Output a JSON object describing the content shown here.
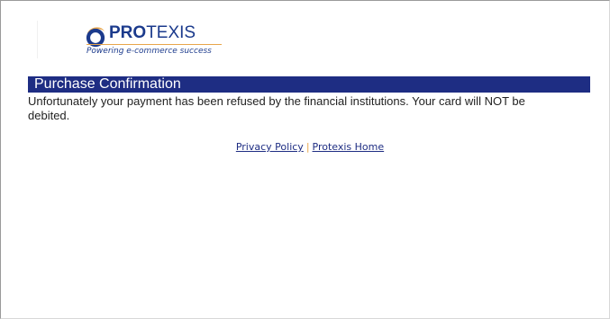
{
  "logo": {
    "brand_prefix": "PRO",
    "brand_suffix": "TEXIS",
    "tagline": "Powering e-commerce success",
    "colors": {
      "blue": "#1b3a8c",
      "orange": "#e8a54a"
    }
  },
  "page": {
    "title": "Purchase Confirmation",
    "title_bar_color": "#1e2d83",
    "message": "Unfortunately your payment has been refused by the financial institutions. Your card will NOT be debited."
  },
  "footer": {
    "privacy_label": "Privacy Policy",
    "separator": "|",
    "home_label": "Protexis Home"
  }
}
